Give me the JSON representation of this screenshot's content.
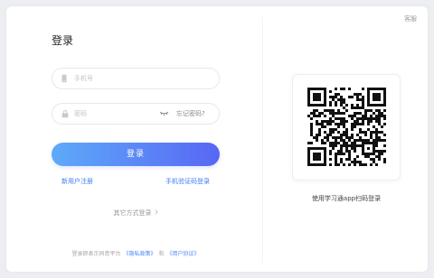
{
  "header": {
    "support_label": "客服"
  },
  "login": {
    "title": "登录",
    "phone": {
      "placeholder": "手机号",
      "value": "",
      "icon": "phone-icon"
    },
    "password": {
      "placeholder": "密码",
      "value": "",
      "icon": "lock-icon",
      "toggle_icon": "eye-closed-icon",
      "forgot_label": "忘记密码?"
    },
    "submit_label": "登录",
    "register_label": "新用户注册",
    "sms_login_label": "手机验证码登录",
    "other_methods_label": "其它方式登录",
    "other_methods_icon": "chevron-right-icon",
    "agreement": {
      "prefix": "登录即表示同意平台",
      "privacy_label": "《隐私政策》",
      "conjunction": "和",
      "terms_label": "《用户协议》"
    }
  },
  "qr_login": {
    "icon": "qr-code-icon",
    "caption": "使用学习通app扫码登录"
  },
  "colors": {
    "accent": "#3b7cf5",
    "button_gradient_start": "#5eaaf9",
    "button_gradient_end": "#5867f4",
    "muted_text": "#999999"
  }
}
